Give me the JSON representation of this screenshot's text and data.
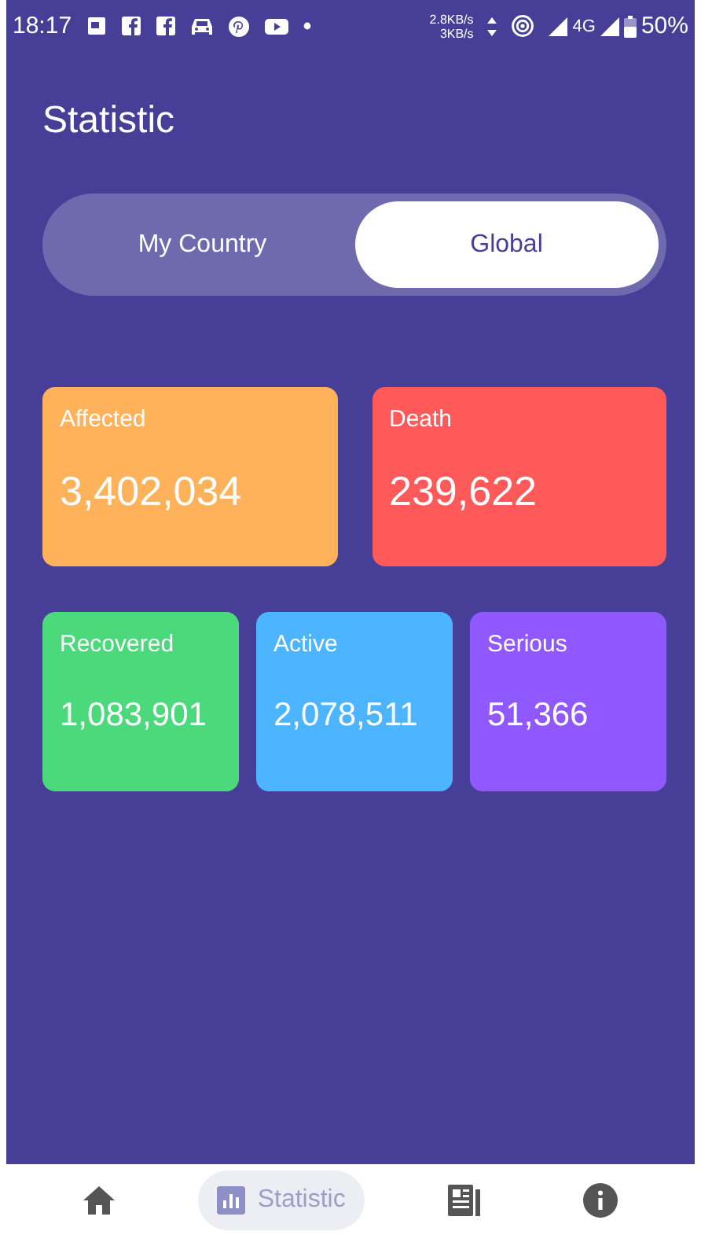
{
  "status_bar": {
    "time": "18:17",
    "speed_up": "2.8KB/s",
    "speed_down": "3KB/s",
    "network": "4G",
    "battery": "50%"
  },
  "title": "Statistic",
  "toggle": [
    {
      "label": "My Country",
      "selected": false
    },
    {
      "label": "Global",
      "selected": true
    }
  ],
  "card_rows": [
    [
      {
        "label": "Affected",
        "value": "3,402,034",
        "color": "#ffb259"
      },
      {
        "label": "Death",
        "value": "239,622",
        "color": "#ff5959"
      }
    ],
    [
      {
        "label": "Recovered",
        "value": "1,083,901",
        "color": "#4cd97b"
      },
      {
        "label": "Active",
        "value": "2,078,511",
        "color": "#4db5ff"
      },
      {
        "label": "Serious",
        "value": "51,366",
        "color": "#9059ff"
      }
    ]
  ],
  "bottom_nav": [
    {
      "kind": "home",
      "selected": false
    },
    {
      "kind": "statistic",
      "label": "Statistic",
      "selected": true
    },
    {
      "kind": "news",
      "selected": false
    },
    {
      "kind": "info",
      "selected": false
    }
  ]
}
